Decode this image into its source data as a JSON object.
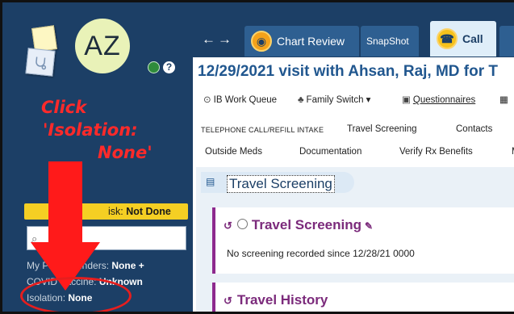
{
  "sidebar": {
    "avatar_initials": "AZ",
    "instruction_lines": [
      "Click",
      "'Isolation:",
      "None'"
    ],
    "task_banner": {
      "label": "isk:",
      "value": "Not Done"
    },
    "search_placeholder": "",
    "reminders": {
      "label": "My Pa",
      "label_hidden_tail": "t Reminders:",
      "value": "None",
      "add": "+"
    },
    "covid": {
      "label": "COVID",
      "label_tail": "Vaccine:",
      "value": "Unknown"
    },
    "isolation": {
      "label": "Isolation:",
      "value": "None"
    },
    "colors": {
      "annotation": "#ff2a2a",
      "sidebar_bg": "#1c3f66",
      "banner": "#f5cf23"
    }
  },
  "topbar": {
    "nav_arrows": "←→",
    "tabs": [
      {
        "label": "Chart Review",
        "icon": "chart-review-icon"
      },
      {
        "label": "SnapShot"
      },
      {
        "label": "Call",
        "icon": "phone-icon",
        "active": true
      }
    ]
  },
  "main": {
    "visit_title": "12/29/2021 visit with Ahsan, Raj, MD for T",
    "toolbar": [
      {
        "label": "IB Work Queue",
        "icon": "work-queue-icon"
      },
      {
        "label": "Family Switch ▾",
        "icon": "family-switch-icon"
      },
      {
        "label": "Questionnaires",
        "icon": "questionnaires-icon"
      }
    ],
    "nav_row1": {
      "phone": "TELEPHONE CALL/REFILL INTAKE",
      "travel": "Travel Screening",
      "contacts": "Contacts"
    },
    "nav_row2": {
      "meds": "Outside Meds",
      "docs": "Documentation",
      "rx": "Verify Rx Benefits",
      "more": "M"
    },
    "section_title": "Travel Screening",
    "card1": {
      "title": "Travel Screening",
      "text": "No screening recorded since 12/28/21 0000"
    },
    "card2": {
      "title": "Travel History"
    },
    "colors": {
      "title": "#21578f",
      "card_accent": "#8e2a8e"
    }
  }
}
